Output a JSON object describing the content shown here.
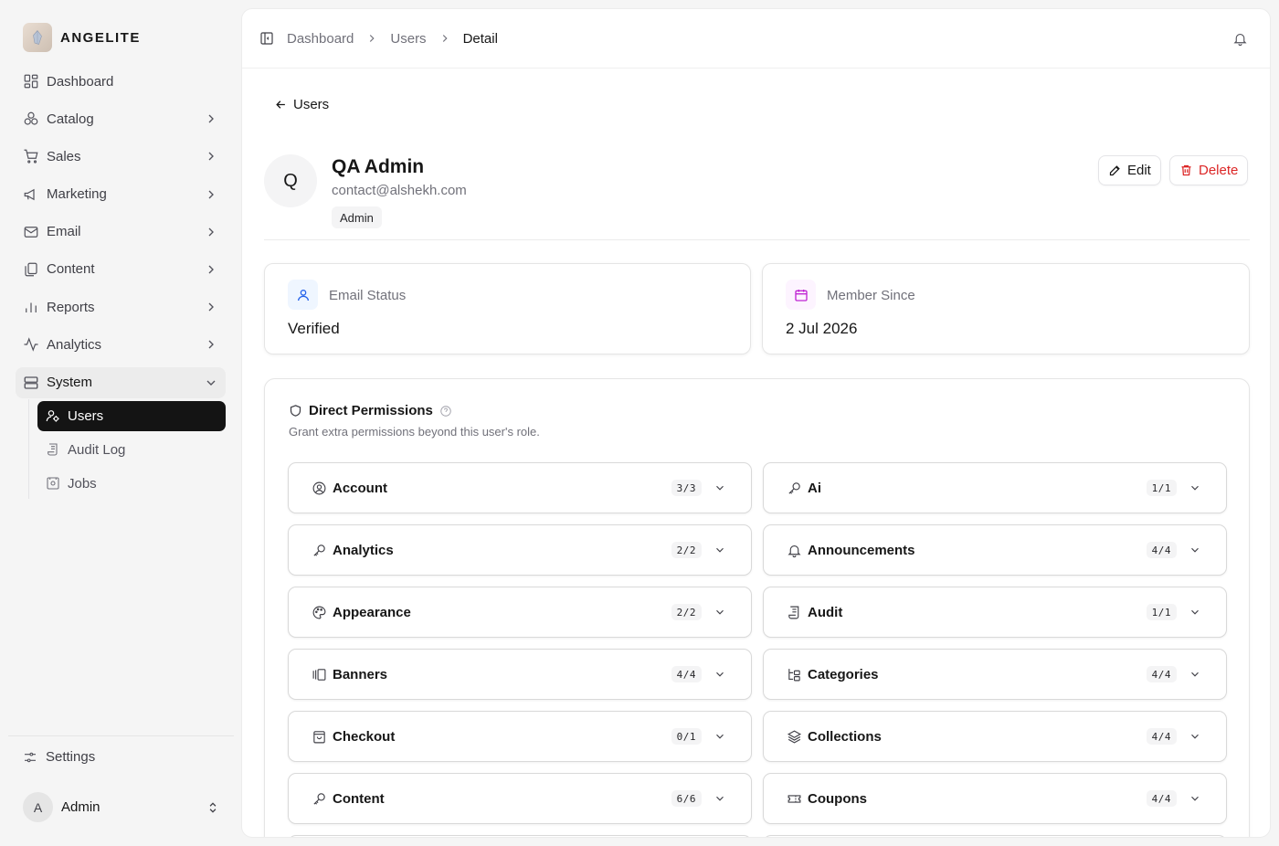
{
  "brand": {
    "name": "ANGELITE"
  },
  "sidebar": {
    "items": [
      {
        "label": "Dashboard",
        "icon": "dashboard-icon"
      },
      {
        "label": "Catalog",
        "icon": "catalog-icon"
      },
      {
        "label": "Sales",
        "icon": "cart-icon"
      },
      {
        "label": "Marketing",
        "icon": "megaphone-icon"
      },
      {
        "label": "Email",
        "icon": "mail-icon"
      },
      {
        "label": "Content",
        "icon": "copy-icon"
      },
      {
        "label": "Reports",
        "icon": "bar-chart-icon"
      },
      {
        "label": "Analytics",
        "icon": "activity-icon"
      },
      {
        "label": "System",
        "icon": "server-icon"
      }
    ],
    "system_sub": [
      {
        "label": "Users",
        "icon": "users-icon"
      },
      {
        "label": "Audit Log",
        "icon": "scroll-icon"
      },
      {
        "label": "Jobs",
        "icon": "jobs-icon"
      }
    ],
    "settings_label": "Settings",
    "user": {
      "initial": "A",
      "name": "Admin"
    }
  },
  "breadcrumb": [
    "Dashboard",
    "Users",
    "Detail"
  ],
  "back_label": "Users",
  "profile": {
    "initial": "Q",
    "name": "QA Admin",
    "email": "contact@alshekh.com",
    "role": "Admin"
  },
  "actions": {
    "edit": "Edit",
    "delete": "Delete"
  },
  "stats": [
    {
      "label": "Email Status",
      "value": "Verified",
      "color": "#2563eb",
      "bg": "#eff6ff"
    },
    {
      "label": "Member Since",
      "value": "2 Jul 2026",
      "color": "#c026d3",
      "bg": "#fdf4ff"
    }
  ],
  "permissions": {
    "title": "Direct Permissions",
    "subtitle": "Grant extra permissions beyond this user's role.",
    "groups": [
      {
        "name": "Account",
        "count": "3/3",
        "icon": "user-circle-icon"
      },
      {
        "name": "Ai",
        "count": "1/1",
        "icon": "key-icon"
      },
      {
        "name": "Analytics",
        "count": "2/2",
        "icon": "key-icon"
      },
      {
        "name": "Announcements",
        "count": "4/4",
        "icon": "bell-icon"
      },
      {
        "name": "Appearance",
        "count": "2/2",
        "icon": "palette-icon"
      },
      {
        "name": "Audit",
        "count": "1/1",
        "icon": "scroll-icon"
      },
      {
        "name": "Banners",
        "count": "4/4",
        "icon": "gallery-icon"
      },
      {
        "name": "Categories",
        "count": "4/4",
        "icon": "tree-icon"
      },
      {
        "name": "Checkout",
        "count": "0/1",
        "icon": "bag-icon"
      },
      {
        "name": "Collections",
        "count": "4/4",
        "icon": "layers-icon"
      },
      {
        "name": "Content",
        "count": "6/6",
        "icon": "key-icon"
      },
      {
        "name": "Coupons",
        "count": "4/4",
        "icon": "ticket-icon"
      }
    ]
  }
}
